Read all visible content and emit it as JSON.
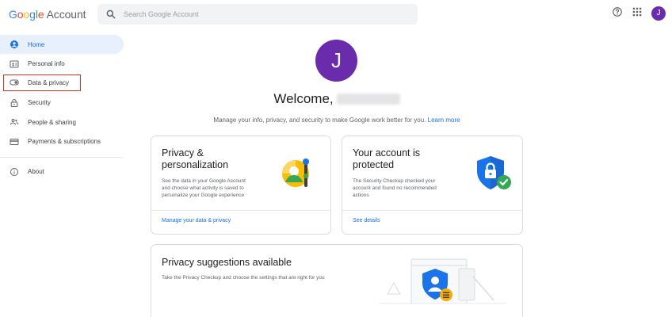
{
  "header": {
    "logo_google": [
      "G",
      "o",
      "o",
      "g",
      "l",
      "e"
    ],
    "logo_account": "Account",
    "search_placeholder": "Search Google Account",
    "help_icon": "help-circle-icon",
    "apps_icon": "apps-grid-icon",
    "avatar_initial": "J"
  },
  "sidebar": {
    "items": [
      {
        "label": "Home",
        "icon": "home-icon"
      },
      {
        "label": "Personal info",
        "icon": "id-card-icon"
      },
      {
        "label": "Data & privacy",
        "icon": "toggle-icon"
      },
      {
        "label": "Security",
        "icon": "lock-icon"
      },
      {
        "label": "People & sharing",
        "icon": "people-icon"
      },
      {
        "label": "Payments & subscriptions",
        "icon": "credit-card-icon"
      },
      {
        "label": "About",
        "icon": "info-icon"
      }
    ]
  },
  "main": {
    "avatar_initial": "J",
    "welcome": "Welcome,",
    "subtitle": "Manage your info, privacy, and security to make Google work better for you.",
    "learn_more": "Learn more",
    "cards": {
      "privacy": {
        "title_line1": "Privacy &",
        "title_line2": "personalization",
        "desc_line1": "See the data in your Google Account",
        "desc_line2": "and choose what activity is saved to",
        "desc_line3": "personalize your Google experience",
        "link": "Manage your data & privacy"
      },
      "security": {
        "title_line1": "Your account is",
        "title_line2": "protected",
        "desc_line1": "The Security Checkup checked your",
        "desc_line2": "account and found no recommended",
        "desc_line3": "actions",
        "link": "See details"
      },
      "suggestions": {
        "title": "Privacy suggestions available",
        "desc": "Take the Privacy Checkup and choose the settings that are right for you"
      }
    }
  },
  "colors": {
    "accent_blue": "#1a73e8",
    "avatar_purple": "#6a2cad",
    "active_nav_bg": "#e8f0fe",
    "highlight_red": "#d93025"
  }
}
